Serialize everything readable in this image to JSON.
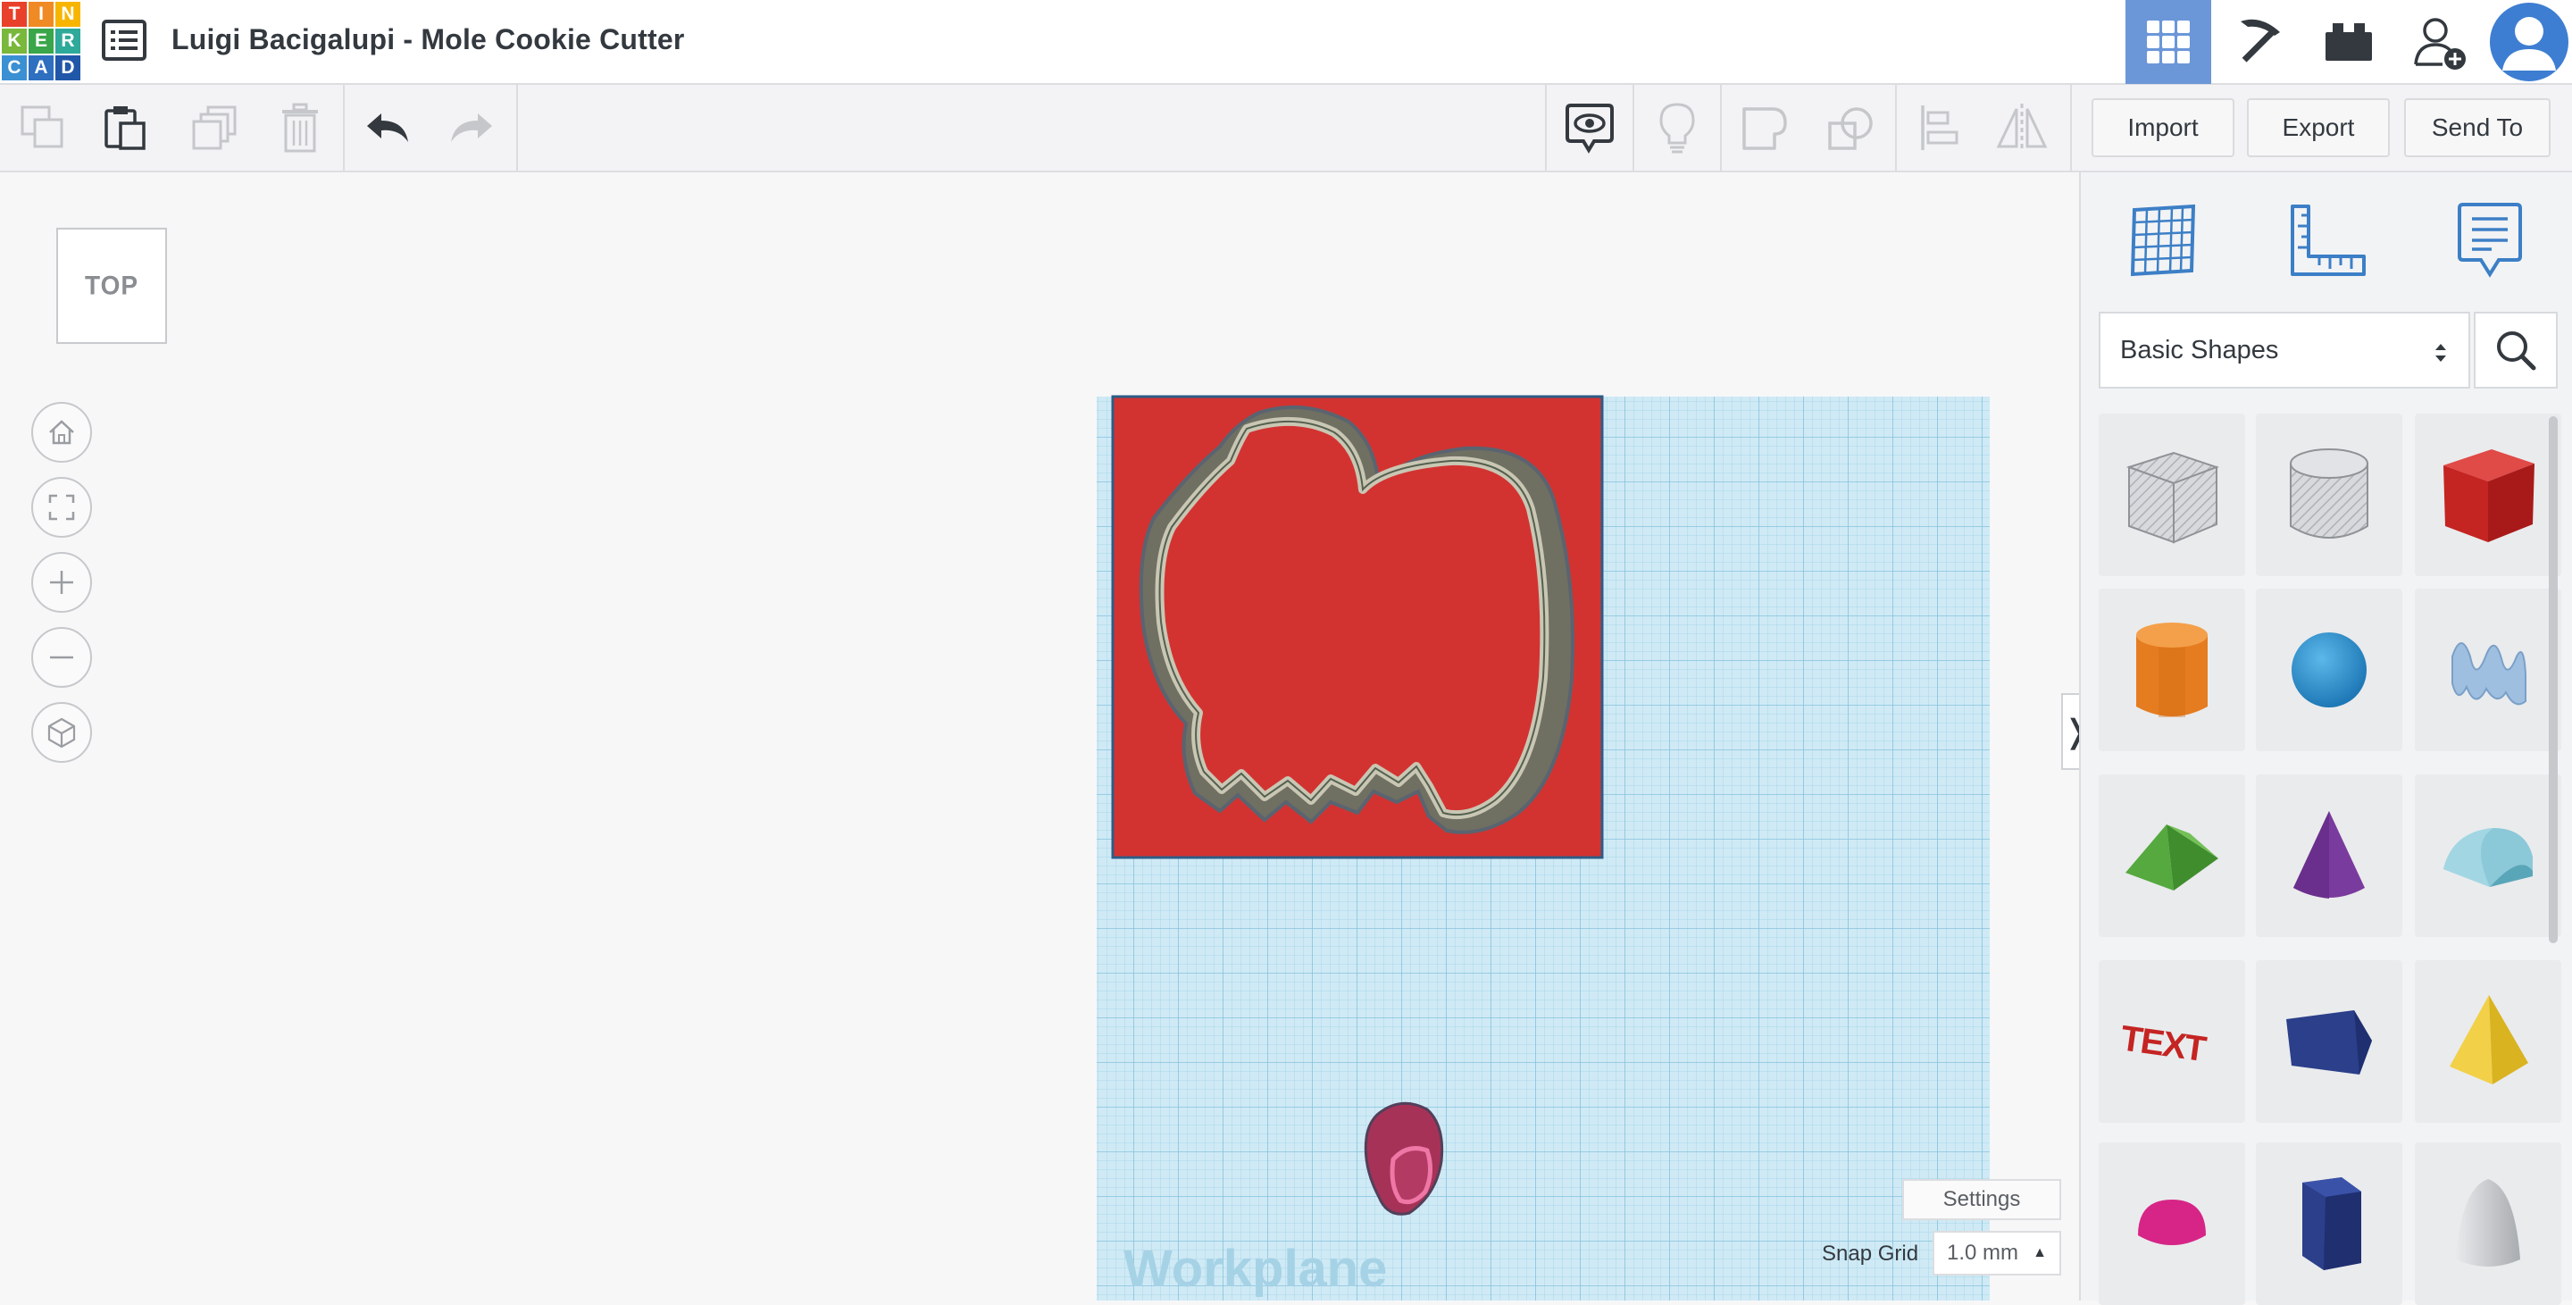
{
  "logo": {
    "letters": [
      "T",
      "I",
      "N",
      "K",
      "E",
      "R",
      "C",
      "A",
      "D"
    ]
  },
  "design": {
    "title": "Luigi Bacigalupi - Mole Cookie Cutter"
  },
  "topnav": {
    "icons": [
      "3d-design-grid-icon",
      "codeblocks-pickaxe-icon",
      "bricks-icon",
      "add-user-icon",
      "user-avatar-icon"
    ]
  },
  "toolbar": {
    "left_tools": [
      "copy-icon",
      "paste-icon",
      "duplicate-icon",
      "trash-icon",
      "undo-icon",
      "redo-icon"
    ],
    "right_tools": [
      "notes-visibility-icon",
      "lightbulb-icon",
      "group-icon",
      "ungroup-icon",
      "align-icon",
      "mirror-icon"
    ],
    "import_label": "Import",
    "export_label": "Export",
    "send_label": "Send To"
  },
  "viewcube": {
    "label": "TOP"
  },
  "nav": {
    "items": [
      "home-icon",
      "fit-view-icon",
      "zoom-in-icon",
      "zoom-out-icon",
      "projection-icon"
    ]
  },
  "workplane": {
    "label": "Workplane",
    "settings_label": "Settings",
    "snap_label": "Snap Grid",
    "snap_value": "1.0 mm"
  },
  "panel": {
    "tabs": [
      "workplane-grid-icon",
      "ruler-icon",
      "notes-icon"
    ],
    "library": "Basic Shapes",
    "shapes": [
      "Box Hole",
      "Cylinder Hole",
      "Box",
      "Cylinder",
      "Sphere",
      "Scribble",
      "Roof",
      "Cone",
      "Round Roof",
      "Text",
      "Wedge",
      "Pyramid",
      "Half Sphere",
      "Polygon",
      "Paraboloid"
    ]
  },
  "colors": {
    "accent": "#4b84ce",
    "red_shape": "#d23331",
    "grid": "#c8e6f2"
  }
}
